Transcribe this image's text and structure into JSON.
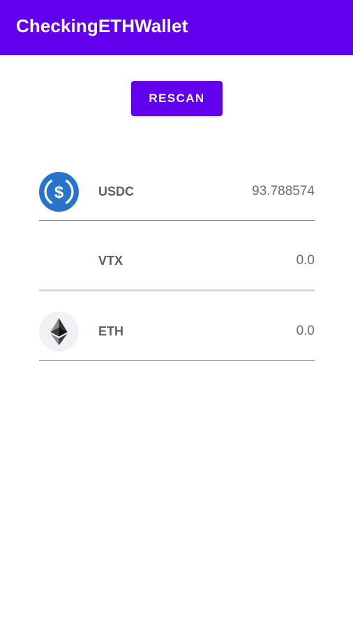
{
  "app_bar": {
    "title": "CheckingETHWallet",
    "color": "#6200ee"
  },
  "actions": {
    "rescan_label": "RESCAN"
  },
  "tokens": [
    {
      "symbol": "USDC",
      "balance": "93.788574",
      "icon": "usdc-icon",
      "icon_color": "#2775ca"
    },
    {
      "symbol": "VTX",
      "balance": "0.0",
      "icon": "none"
    },
    {
      "symbol": "ETH",
      "balance": "0.0",
      "icon": "ethereum-icon"
    }
  ]
}
